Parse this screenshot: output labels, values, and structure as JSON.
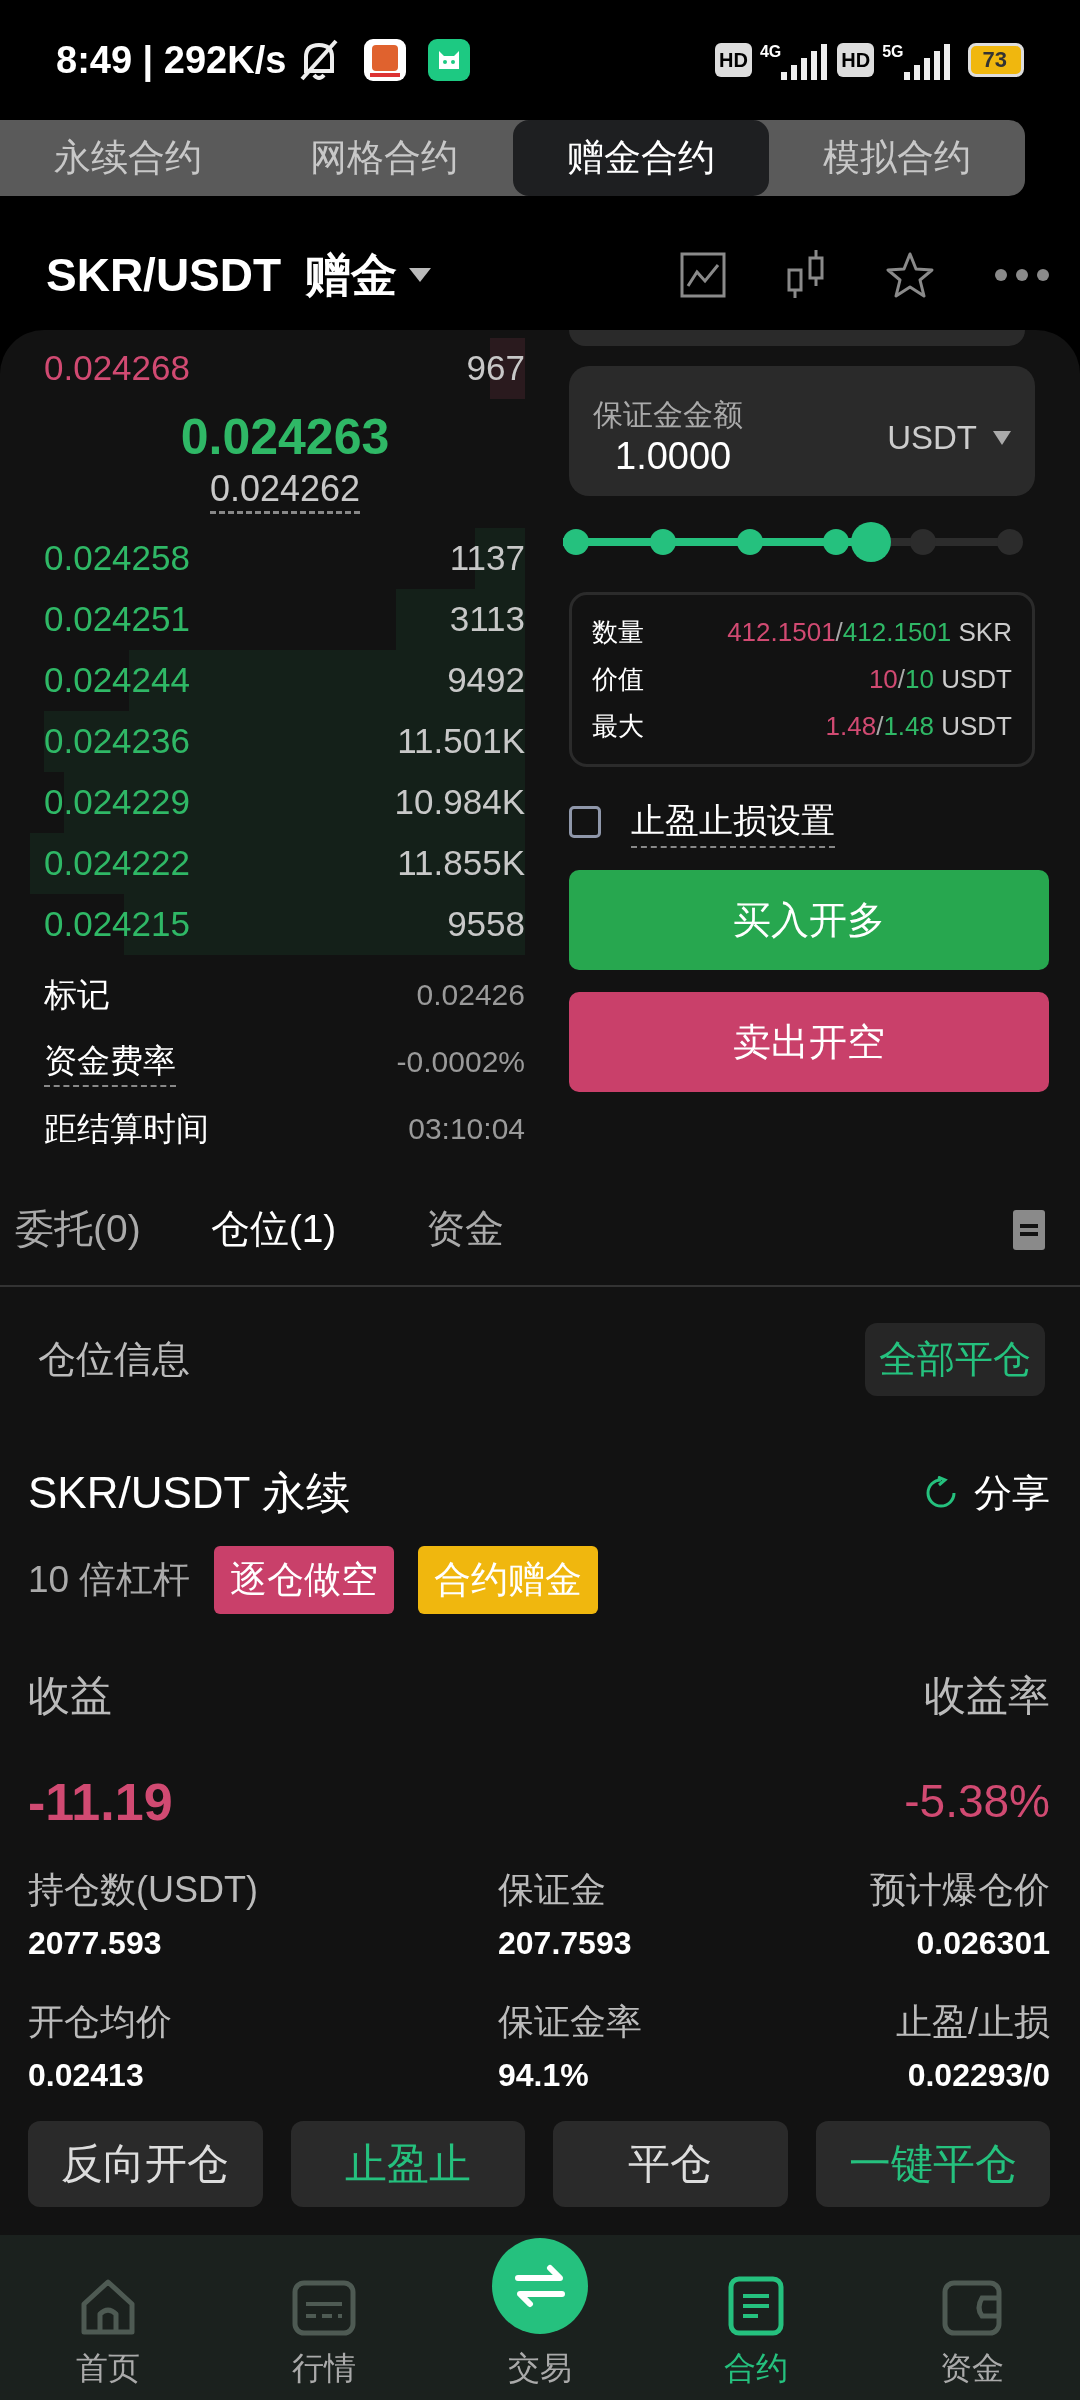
{
  "status_bar": {
    "time": "8:49 | 292K/s",
    "sim1_tag": "HD",
    "sim1_network": "4G",
    "sim2_tag": "HD",
    "sim2_network": "5G",
    "battery": "73"
  },
  "contract_tabs": [
    {
      "label": "永续合约",
      "selected": false
    },
    {
      "label": "网格合约",
      "selected": false
    },
    {
      "label": "赠金合约",
      "selected": true
    },
    {
      "label": "模拟合约",
      "selected": false
    }
  ],
  "header": {
    "pair": "SKR/USDT",
    "badge": "赠金"
  },
  "order_book": {
    "asks": [
      {
        "price": "0.024268",
        "amount": "967"
      }
    ],
    "last_price": "0.024263",
    "mark_price": "0.024262",
    "bids": [
      {
        "price": "0.024258",
        "amount": "1137"
      },
      {
        "price": "0.024251",
        "amount": "3113"
      },
      {
        "price": "0.024244",
        "amount": "9492"
      },
      {
        "price": "0.024236",
        "amount": "11.501K"
      },
      {
        "price": "0.024229",
        "amount": "10.984K"
      },
      {
        "price": "0.024222",
        "amount": "11.855K"
      },
      {
        "price": "0.024215",
        "amount": "9558"
      }
    ],
    "stats": [
      {
        "label": "标记",
        "value": "0.02426",
        "dotted": false
      },
      {
        "label": "资金费率",
        "value": "-0.0002%",
        "dotted": true
      },
      {
        "label": "距结算时间",
        "value": "03:10:04",
        "dotted": false
      }
    ]
  },
  "order_form": {
    "margin_field": {
      "label": "保证金金额",
      "value": "1.0000",
      "unit": "USDT"
    },
    "leverage_slider": {
      "level": 0.67
    },
    "summary": [
      {
        "label": "数量",
        "sell": "412.1501",
        "separator": "/",
        "buy": "412.1501",
        "unit": "SKR"
      },
      {
        "label": "价值",
        "sell": "10",
        "separator": "/",
        "buy": "10",
        "unit": "USDT"
      },
      {
        "label": "最大",
        "sell": "1.48",
        "separator": "/",
        "buy": "1.48",
        "unit": "USDT"
      }
    ],
    "tpsl": {
      "label": "止盈止损设置",
      "checked": false
    },
    "buttons": [
      {
        "label": "买入开多",
        "kind": "buy"
      },
      {
        "label": "卖出开空",
        "kind": "sell"
      }
    ]
  },
  "record_tabs": [
    {
      "label": "委托(0)",
      "selected": false
    },
    {
      "label": "仓位(1)",
      "selected": true
    },
    {
      "label": "资金",
      "selected": false
    }
  ],
  "positions_header": {
    "title": "仓位信息",
    "close_all": "全部平仓"
  },
  "position": {
    "symbol": "SKR/USDT 永续",
    "share": "分享",
    "leverage": "10 倍杠杆",
    "tags": [
      {
        "label": "逐仓做空",
        "color": "#c9406a"
      },
      {
        "label": "合约赠金",
        "color": "#f0b70e"
      }
    ],
    "pnl_label": "收益",
    "pnl_rate_label": "收益率",
    "pnl": "-11.19",
    "pnl_rate": "-5.38%",
    "fields": [
      {
        "label": "持仓数(USDT)",
        "value": "2077.593"
      },
      {
        "label": "保证金",
        "value": "207.7593"
      },
      {
        "label": "预计爆仓价",
        "value": "0.026301"
      },
      {
        "label": "开仓均价",
        "value": "0.02413"
      },
      {
        "label": "保证金率",
        "value": "94.1%"
      },
      {
        "label": "止盈/止损",
        "value": "0.02293/0"
      }
    ],
    "actions": [
      {
        "label": "反向开仓",
        "kind": "plain"
      },
      {
        "label": "止盈止",
        "kind": "accent"
      },
      {
        "label": "平仓",
        "kind": "plain"
      },
      {
        "label": "一键平仓",
        "kind": "accent"
      }
    ]
  },
  "nav": [
    {
      "label": "首页",
      "kind": "home",
      "selected": false
    },
    {
      "label": "行情",
      "kind": "market",
      "selected": false
    },
    {
      "label": "交易",
      "kind": "trade",
      "selected": false
    },
    {
      "label": "合约",
      "kind": "contract",
      "selected": true
    },
    {
      "label": "资金",
      "kind": "wallet",
      "selected": false
    }
  ]
}
